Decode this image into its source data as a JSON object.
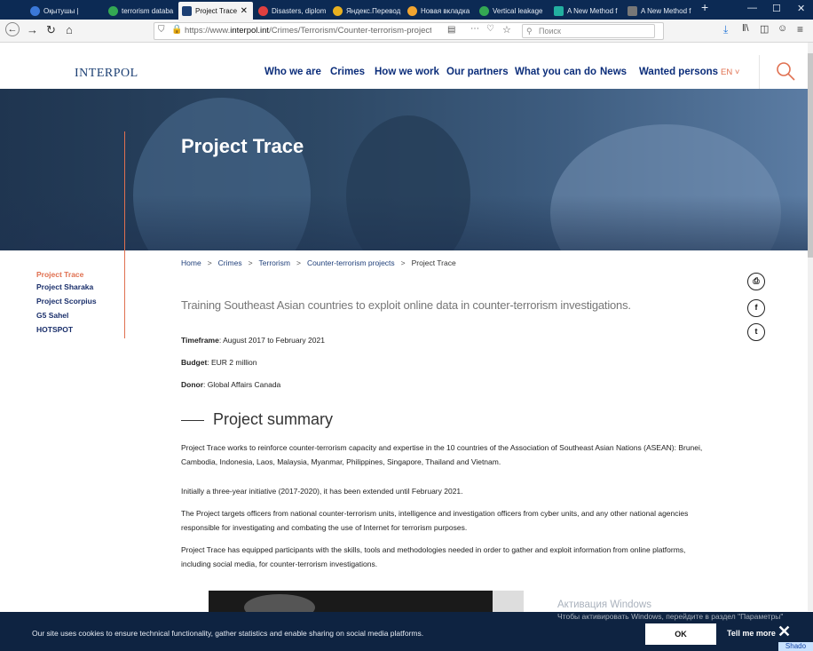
{
  "browser": {
    "tabs": [
      {
        "label": "Оқытушы |",
        "color": "#3b78d8"
      },
      {
        "label": "terrorism databa",
        "color": "#34a853"
      },
      {
        "label": "Project Trace",
        "color": "#1c3f73",
        "active": true
      },
      {
        "label": "Disasters, diplom",
        "color": "#e04040"
      },
      {
        "label": "Яндекс.Перевод",
        "color": "#e8b020"
      },
      {
        "label": "Новая вкладка",
        "color": "#e8b020"
      },
      {
        "label": "Vertical leakage",
        "color": "#34a853"
      },
      {
        "label": "A New Method f",
        "color": "#22b0a0"
      },
      {
        "label": "A New Method f",
        "color": "#777777"
      }
    ],
    "tab_close": "✕",
    "new_tab": "+",
    "url_prefix": "https://www.",
    "url_domain": "interpol.int",
    "url_path": "/Crimes/Terrorism/Counter-terrorism-projects/",
    "search_placeholder": "Поиск"
  },
  "site": {
    "logo": "INTERPOL",
    "nav": [
      "Who we are",
      "Crimes",
      "How we work",
      "Our partners",
      "What you can do",
      "News",
      "Wanted persons"
    ],
    "lang": "EN ˅"
  },
  "hero": {
    "title": "Project Trace"
  },
  "sidemenu": [
    "Project Trace",
    "Project Sharaka",
    "Project Scorpius",
    "G5 Sahel",
    "HOTSPOT"
  ],
  "breadcrumb": [
    "Home",
    "Crimes",
    "Terrorism",
    "Counter-terrorism projects",
    "Project Trace"
  ],
  "breadcrumb_sep": ">",
  "share": {
    "print": "⎙",
    "facebook": "f",
    "twitter": "t"
  },
  "lead": "Training Southeast Asian countries to exploit online data in counter-terrorism investigations.",
  "meta": {
    "timeframe_label": "Timeframe",
    "timeframe": ": August 2017 to February 2021",
    "budget_label": "Budget",
    "budget": ": EUR 2 million",
    "donor_label": "Donor",
    "donor": ": Global Affairs Canada"
  },
  "summary": {
    "heading": "Project summary",
    "paragraphs": [
      "Project Trace works to reinforce counter-terrorism capacity and expertise in the 10 countries of the Association of Southeast Asian Nations (ASEAN): Brunei, Cambodia, Indonesia, Laos, Malaysia, Myanmar, Philippines, Singapore, Thailand and Vietnam.",
      "Initially a three-year initiative (2017-2020), it has been extended until February 2021.",
      "The Project targets officers from national counter-terrorism units, intelligence and investigation officers from cyber units, and any other national agencies responsible for investigating and combating the use of Internet for terrorism purposes.",
      "Project Trace has equipped participants with the skills, tools and methodologies needed in order to gather and exploit information from online platforms, including social media, for counter-terrorism investigations."
    ]
  },
  "cookie": {
    "text": "Our site uses cookies to ensure technical functionality, gather statistics and enable sharing on social media platforms.",
    "ok": "OK",
    "tell_more": "Tell me more",
    "close": "✕"
  },
  "os_overlay": {
    "activation_title": "Активация Windows",
    "activation_text": "Чтобы активировать Windows, перейдите в раздел \"Параметры\"",
    "badge": "Shado"
  }
}
